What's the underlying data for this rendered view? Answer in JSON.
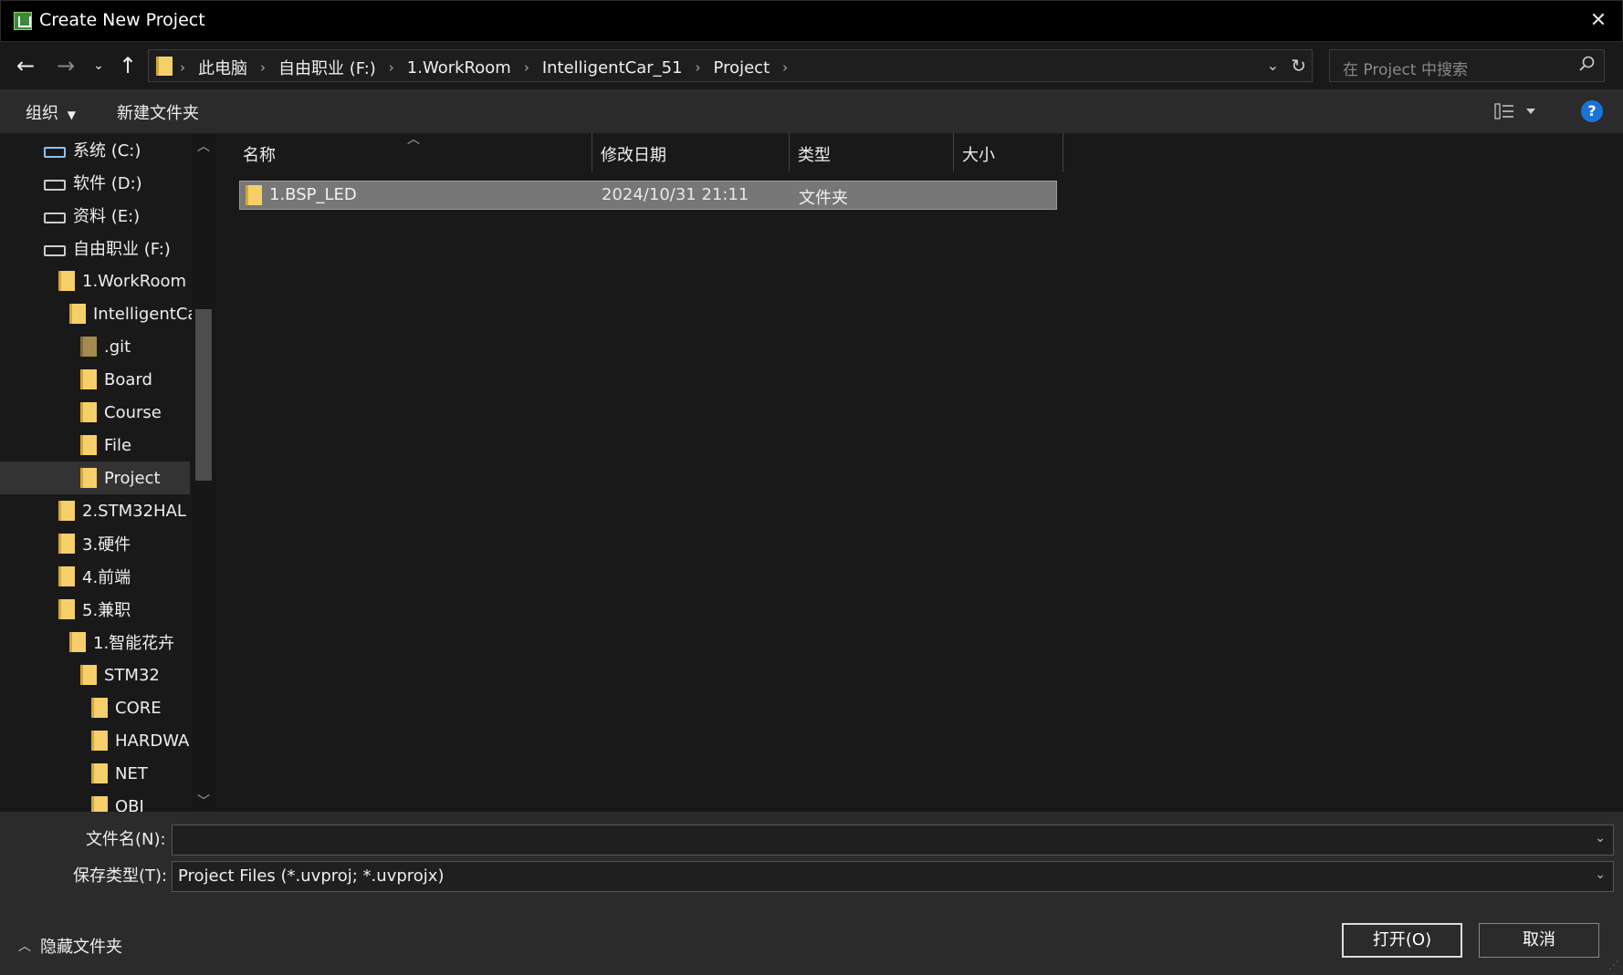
{
  "window": {
    "title": "Create New Project"
  },
  "address": {
    "crumbs": [
      "此电脑",
      "自由职业 (F:)",
      "1.WorkRoom",
      "IntelligentCar_51",
      "Project"
    ],
    "search_placeholder": "在 Project 中搜索"
  },
  "toolbar": {
    "organize": "组织",
    "new_folder": "新建文件夹"
  },
  "sidebar": {
    "items": [
      {
        "label": "系统 (C:)",
        "icon": "drive-system-icon"
      },
      {
        "label": "软件 (D:)",
        "icon": "drive-icon"
      },
      {
        "label": "资料 (E:)",
        "icon": "drive-icon"
      },
      {
        "label": "自由职业 (F:)",
        "icon": "drive-icon"
      },
      {
        "label": "1.WorkRoom",
        "icon": "folder-icon"
      },
      {
        "label": "IntelligentCa",
        "icon": "folder-icon"
      },
      {
        "label": ".git",
        "icon": "folder-icon"
      },
      {
        "label": "Board",
        "icon": "folder-icon"
      },
      {
        "label": "Course",
        "icon": "folder-icon"
      },
      {
        "label": "File",
        "icon": "folder-icon"
      },
      {
        "label": "Project",
        "icon": "folder-icon"
      },
      {
        "label": "2.STM32HAL",
        "icon": "folder-icon"
      },
      {
        "label": "3.硬件",
        "icon": "folder-icon"
      },
      {
        "label": "4.前端",
        "icon": "folder-icon"
      },
      {
        "label": "5.兼职",
        "icon": "folder-icon"
      },
      {
        "label": "1.智能花卉",
        "icon": "folder-icon"
      },
      {
        "label": "STM32",
        "icon": "folder-icon"
      },
      {
        "label": "CORE",
        "icon": "folder-icon"
      },
      {
        "label": "HARDWA",
        "icon": "folder-icon"
      },
      {
        "label": "NET",
        "icon": "folder-icon"
      },
      {
        "label": "OBJ",
        "icon": "folder-icon"
      }
    ]
  },
  "columns": {
    "name": "名称",
    "modified": "修改日期",
    "type": "类型",
    "size": "大小"
  },
  "files": [
    {
      "name": "1.BSP_LED",
      "modified": "2024/10/31 21:11",
      "type": "文件夹",
      "size": ""
    }
  ],
  "form": {
    "filename_label": "文件名(N):",
    "filename_value": "",
    "savetype_label": "保存类型(T):",
    "savetype_value": "Project Files (*.uvproj; *.uvprojx)"
  },
  "footer": {
    "hide_folders": "隐藏文件夹",
    "open": "打开(O)",
    "cancel": "取消"
  },
  "colors": {
    "help": "#1a73d8",
    "folder": "#f5d06a",
    "selected_row": "#777777"
  }
}
